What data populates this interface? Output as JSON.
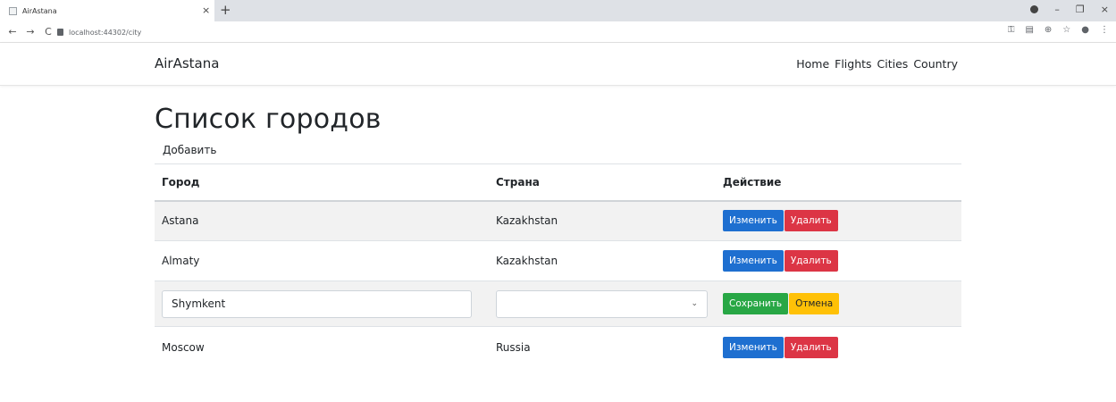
{
  "browser": {
    "tab_title": "AirAstana",
    "tab_close": "×",
    "new_tab": "+",
    "url": "localhost:44302/city",
    "win_minimize": "–",
    "win_restore": "❐",
    "win_close": "×",
    "nav_back": "←",
    "nav_forward": "→",
    "nav_reload": "C",
    "addr_icons": {
      "key": "⚿",
      "translate": "▤",
      "zoom": "⊕",
      "star": "☆",
      "profile": "●",
      "menu": "⋮"
    }
  },
  "navbar": {
    "brand": "AirAstana",
    "links": [
      "Home",
      "Flights",
      "Cities",
      "Country"
    ]
  },
  "page": {
    "title": "Список городов",
    "add_link": "Добавить"
  },
  "table": {
    "headers": [
      "Город",
      "Страна",
      "Действие"
    ],
    "rows": [
      {
        "city": "Astana",
        "country": "Kazakhstan",
        "edit": "Изменить",
        "delete": "Удалить"
      },
      {
        "city": "Almaty",
        "country": "Kazakhstan",
        "edit": "Изменить",
        "delete": "Удалить"
      },
      {
        "city_input": "Shymkent",
        "country_select": "",
        "save": "Сохранить",
        "cancel": "Отмена"
      },
      {
        "city": "Moscow",
        "country": "Russia",
        "edit": "Изменить",
        "delete": "Удалить"
      }
    ]
  },
  "colors": {
    "edit_button": "#1e6fd0",
    "delete_button": "#dc3545",
    "save_button": "#28a745",
    "cancel_button": "#ffc107"
  }
}
